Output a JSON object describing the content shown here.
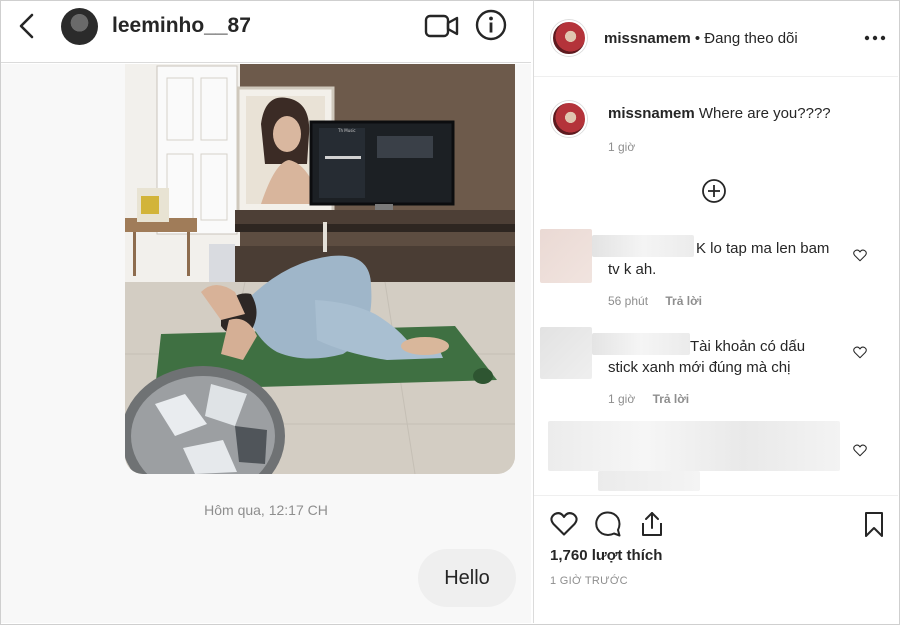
{
  "dm": {
    "username": "leeminho__87",
    "timestamp": "Hôm qua, 12:17 CH",
    "message": "Hello"
  },
  "post": {
    "author": "missnamem",
    "follow_status": "• Đang theo dõi",
    "caption_author": "missnamem",
    "caption_text": "Where are you????",
    "caption_time": "1 giờ",
    "comments": [
      {
        "line1": "K lo tap ma len bam",
        "line2": "tv k ah.",
        "time": "56 phút",
        "reply": "Trả lời"
      },
      {
        "line1": "Tài khoản có dấu",
        "line2": "stick xanh mới đúng mà chị",
        "time": "1 giờ",
        "reply": "Trả lời"
      }
    ],
    "likes": "1,760 lượt thích",
    "date": "1 GIỜ TRƯỚC"
  },
  "photo_screen_lettering": "Th Music"
}
